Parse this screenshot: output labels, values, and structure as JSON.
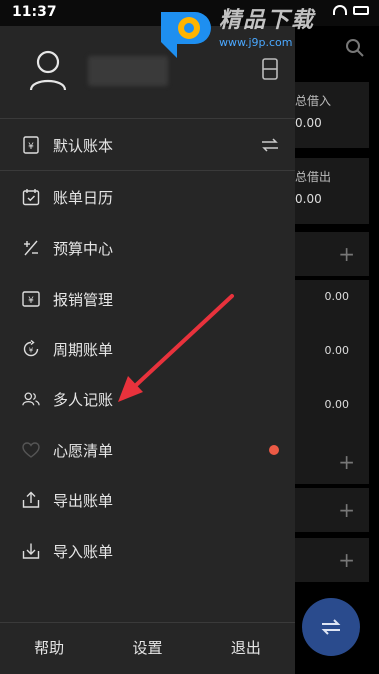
{
  "status_bar": {
    "time": "11:37"
  },
  "watermark": {
    "title": "精品下载",
    "url": "www.j9p.com"
  },
  "drawer": {
    "default_book": {
      "label": "默认账本"
    },
    "menu": [
      {
        "label": "账单日历",
        "icon": "calendar-icon"
      },
      {
        "label": "预算中心",
        "icon": "budget-icon"
      },
      {
        "label": "报销管理",
        "icon": "reimburse-icon"
      },
      {
        "label": "周期账单",
        "icon": "cycle-icon"
      },
      {
        "label": "多人记账",
        "icon": "users-icon"
      },
      {
        "label": "心愿清单",
        "icon": "heart-icon",
        "badge": true
      },
      {
        "label": "导出账单",
        "icon": "export-icon"
      },
      {
        "label": "导入账单",
        "icon": "import-icon"
      }
    ],
    "bottom": {
      "help": "帮助",
      "settings": "设置",
      "logout": "退出"
    }
  },
  "background": {
    "total_borrow_in_label": "总借入",
    "total_borrow_in_value": "0.00",
    "total_borrow_out_label": "总借出",
    "total_borrow_out_value": "0.00",
    "amounts": [
      "0.00",
      "0.00",
      "0.00"
    ]
  },
  "colors": {
    "drawer_bg": "#262626",
    "badge": "#ec5a45",
    "fab": "#2a4b8d",
    "arrow": "#e8323c"
  }
}
